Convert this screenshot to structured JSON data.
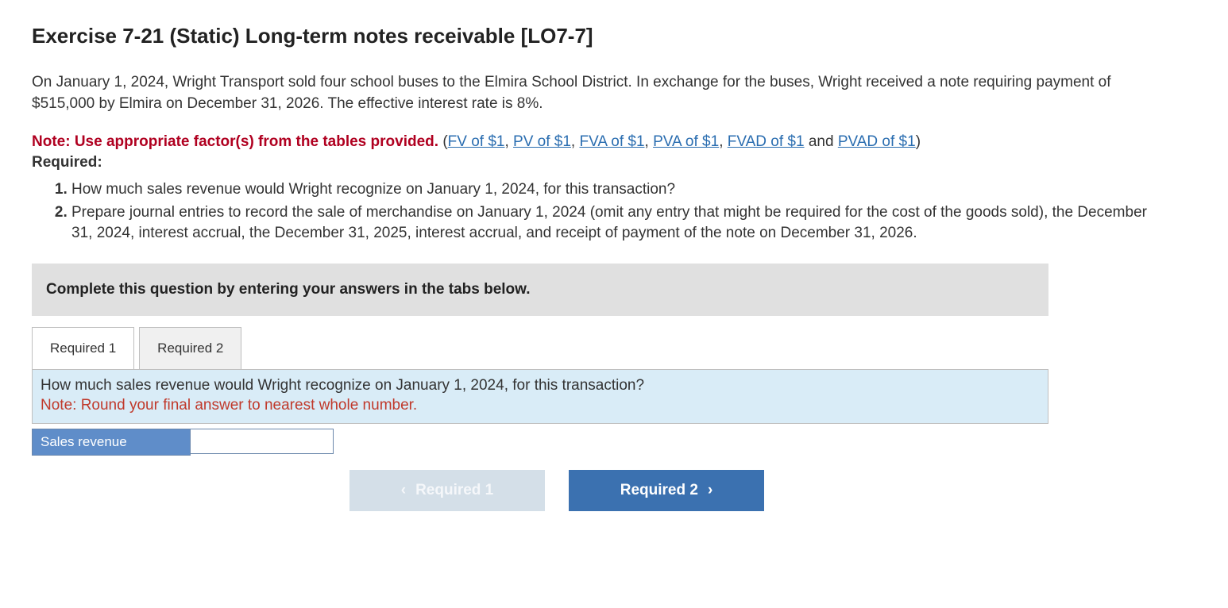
{
  "title": "Exercise 7-21 (Static) Long-term notes receivable [LO7-7]",
  "scenario": "On January 1, 2024, Wright Transport sold four school buses to the Elmira School District. In exchange for the buses, Wright received a note requiring payment of $515,000 by Elmira on December 31, 2026. The effective interest rate is 8%.",
  "note_prefix": "Note: Use appropriate factor(s) from the tables provided.",
  "table_links": {
    "fv": "FV of $1",
    "pv": "PV of $1",
    "fva": "FVA of $1",
    "pva": "PVA of $1",
    "fvad": "FVAD of $1",
    "pvad": "PVAD of $1"
  },
  "and_word": "and",
  "required_label": "Required:",
  "requirements": [
    "How much sales revenue would Wright recognize on January 1, 2024, for this transaction?",
    "Prepare journal entries to record the sale of merchandise on January 1, 2024 (omit any entry that might be required for the cost of the goods sold), the December 31, 2024, interest accrual, the December 31, 2025, interest accrual, and receipt of payment of the note on December 31, 2026."
  ],
  "instruction_bar": "Complete this question by entering your answers in the tabs below.",
  "tabs": {
    "t1": "Required 1",
    "t2": "Required 2"
  },
  "tabpanel": {
    "question": "How much sales revenue would Wright recognize on January 1, 2024, for this transaction?",
    "round_note": "Note: Round your final answer to nearest whole number.",
    "answer_label": "Sales revenue",
    "answer_value": ""
  },
  "nav": {
    "prev": "Required 1",
    "next": "Required 2"
  },
  "glyph": {
    "left": "‹",
    "right": "›"
  }
}
